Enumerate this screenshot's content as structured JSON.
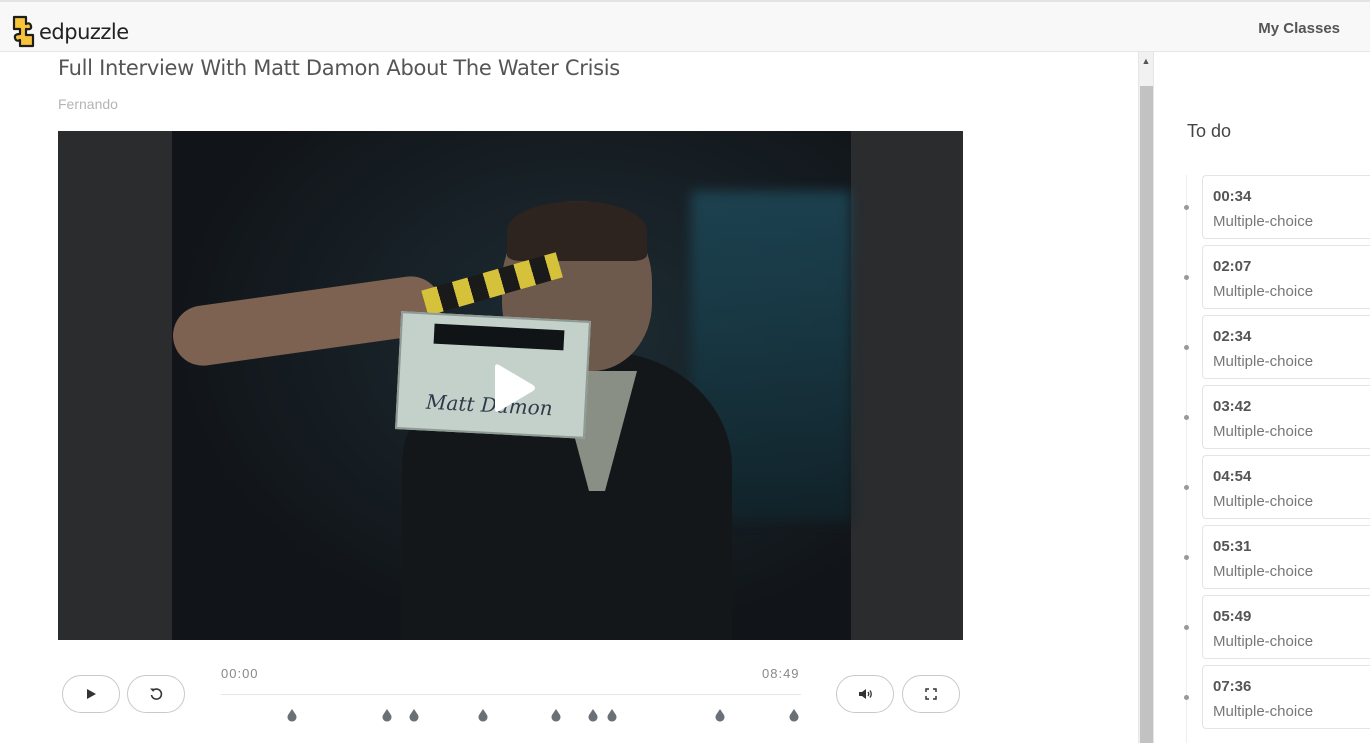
{
  "header": {
    "logo_text": "edpuzzle",
    "nav_link": "My Classes"
  },
  "video": {
    "title": "Full Interview With Matt Damon About The Water Crisis",
    "author": "Fernando",
    "frame_text": "Matt Damon",
    "current_time": "00:00",
    "duration": "08:49",
    "question_markers": [
      "00:34",
      "02:07",
      "02:34",
      "03:42",
      "04:54",
      "05:31",
      "05:49",
      "07:36",
      "08:49"
    ]
  },
  "controls": {
    "play_icon": "play-icon",
    "rewind_icon": "rewind-icon",
    "volume_icon": "volume-icon",
    "fullscreen_icon": "fullscreen-icon"
  },
  "sidebar": {
    "title": "To do",
    "questions": [
      {
        "time": "00:34",
        "type": "Multiple-choice"
      },
      {
        "time": "02:07",
        "type": "Multiple-choice"
      },
      {
        "time": "02:34",
        "type": "Multiple-choice"
      },
      {
        "time": "03:42",
        "type": "Multiple-choice"
      },
      {
        "time": "04:54",
        "type": "Multiple-choice"
      },
      {
        "time": "05:31",
        "type": "Multiple-choice"
      },
      {
        "time": "05:49",
        "type": "Multiple-choice"
      },
      {
        "time": "07:36",
        "type": "Multiple-choice"
      }
    ]
  },
  "colors": {
    "brand_yellow": "#f6c33b",
    "marker": "#6b7076"
  }
}
